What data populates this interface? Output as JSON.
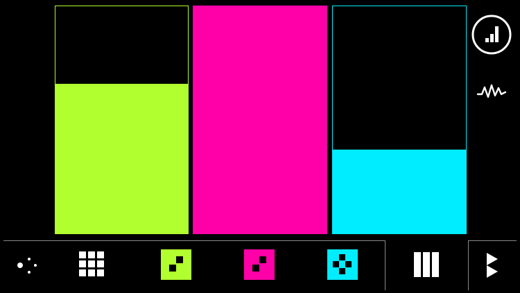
{
  "colors": {
    "background": "#000000",
    "lime": "#b1ff2e",
    "magenta": "#ff00a8",
    "cyan": "#00ecff",
    "frame": "#8a8a8a",
    "icon": "#ffffff"
  },
  "bars": [
    {
      "name": "lime",
      "level": 0.66
    },
    {
      "name": "magenta",
      "level": 1.0
    },
    {
      "name": "cyan",
      "level": 0.37
    }
  ],
  "icons": {
    "bars_chart": "bar-chart-icon",
    "waveform": "waveform-icon",
    "dots": "dots-icon",
    "grid": "grid-icon",
    "pattern_lime": "lime-pattern-icon",
    "pattern_magenta": "magenta-pattern-icon",
    "pattern_cyan": "cyan-pattern-icon",
    "columns": "columns-icon",
    "play": "play-icon"
  }
}
